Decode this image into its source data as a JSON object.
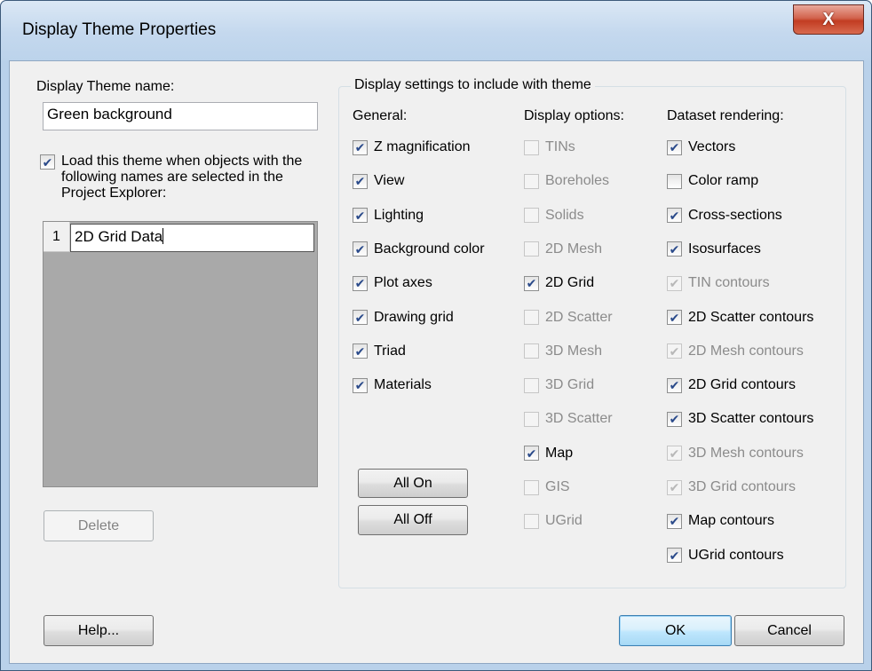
{
  "window": {
    "title": "Display Theme Properties",
    "close_label": "X"
  },
  "left": {
    "name_label": "Display Theme name:",
    "name_value": "Green background",
    "load_checkbox": {
      "label": "Load this theme when objects with the following names are selected in the Project Explorer:",
      "checked": true
    },
    "list": {
      "row_number": "1",
      "row_value": "2D Grid Data"
    },
    "delete_label": "Delete"
  },
  "group": {
    "title": "Display settings to include with theme",
    "general": {
      "header": "General:",
      "items": [
        {
          "label": "Z magnification",
          "checked": true,
          "enabled": true
        },
        {
          "label": "View",
          "checked": true,
          "enabled": true
        },
        {
          "label": "Lighting",
          "checked": true,
          "enabled": true
        },
        {
          "label": "Background color",
          "checked": true,
          "enabled": true
        },
        {
          "label": "Plot axes",
          "checked": true,
          "enabled": true
        },
        {
          "label": "Drawing grid",
          "checked": true,
          "enabled": true
        },
        {
          "label": "Triad",
          "checked": true,
          "enabled": true
        },
        {
          "label": "Materials",
          "checked": true,
          "enabled": true
        }
      ]
    },
    "display": {
      "header": "Display options:",
      "items": [
        {
          "label": "TINs",
          "checked": false,
          "enabled": false
        },
        {
          "label": "Boreholes",
          "checked": false,
          "enabled": false
        },
        {
          "label": "Solids",
          "checked": false,
          "enabled": false
        },
        {
          "label": "2D Mesh",
          "checked": false,
          "enabled": false
        },
        {
          "label": "2D Grid",
          "checked": true,
          "enabled": true
        },
        {
          "label": "2D Scatter",
          "checked": false,
          "enabled": false
        },
        {
          "label": "3D Mesh",
          "checked": false,
          "enabled": false
        },
        {
          "label": "3D Grid",
          "checked": false,
          "enabled": false
        },
        {
          "label": "3D Scatter",
          "checked": false,
          "enabled": false
        },
        {
          "label": "Map",
          "checked": true,
          "enabled": true
        },
        {
          "label": "GIS",
          "checked": false,
          "enabled": false
        },
        {
          "label": "UGrid",
          "checked": false,
          "enabled": false
        }
      ]
    },
    "dataset": {
      "header": "Dataset rendering:",
      "items": [
        {
          "label": "Vectors",
          "checked": true,
          "enabled": true
        },
        {
          "label": "Color ramp",
          "checked": false,
          "enabled": true
        },
        {
          "label": "Cross-sections",
          "checked": true,
          "enabled": true
        },
        {
          "label": "Isosurfaces",
          "checked": true,
          "enabled": true
        },
        {
          "label": "TIN contours",
          "checked": true,
          "enabled": false
        },
        {
          "label": "2D Scatter contours",
          "checked": true,
          "enabled": true
        },
        {
          "label": "2D Mesh contours",
          "checked": true,
          "enabled": false
        },
        {
          "label": "2D Grid contours",
          "checked": true,
          "enabled": true
        },
        {
          "label": "3D Scatter contours",
          "checked": true,
          "enabled": true
        },
        {
          "label": "3D Mesh contours",
          "checked": true,
          "enabled": false
        },
        {
          "label": "3D Grid contours",
          "checked": true,
          "enabled": false
        },
        {
          "label": "Map contours",
          "checked": true,
          "enabled": true
        },
        {
          "label": "UGrid contours",
          "checked": true,
          "enabled": true
        }
      ]
    },
    "all_on_label": "All On",
    "all_off_label": "All Off"
  },
  "footer": {
    "help_label": "Help...",
    "ok_label": "OK",
    "cancel_label": "Cancel"
  }
}
